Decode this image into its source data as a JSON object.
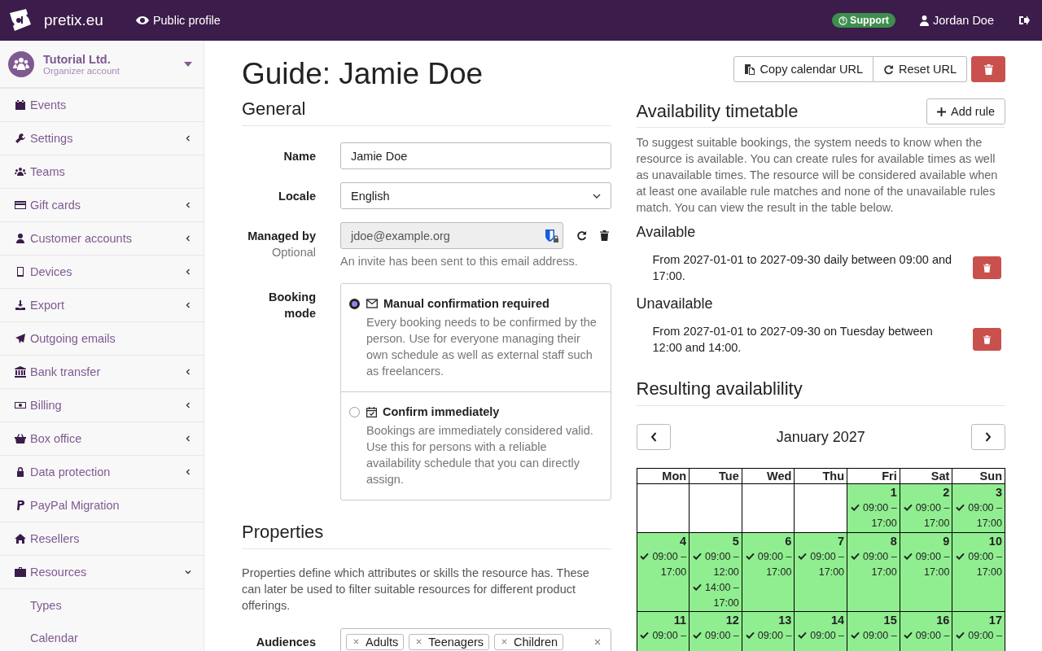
{
  "topbar": {
    "brand": "pretix.eu",
    "public_profile": "Public profile",
    "support": "Support",
    "user": "Jordan Doe"
  },
  "organizer": {
    "name": "Tutorial Ltd.",
    "subtitle": "Organizer account"
  },
  "sidebar": {
    "items": [
      {
        "label": "Events",
        "kind": "link",
        "expanded": false
      },
      {
        "label": "Settings",
        "kind": "menu",
        "expanded": false
      },
      {
        "label": "Teams",
        "kind": "link",
        "expanded": false
      },
      {
        "label": "Gift cards",
        "kind": "menu",
        "expanded": false
      },
      {
        "label": "Customer accounts",
        "kind": "menu",
        "expanded": false
      },
      {
        "label": "Devices",
        "kind": "menu",
        "expanded": false
      },
      {
        "label": "Export",
        "kind": "menu",
        "expanded": false
      },
      {
        "label": "Outgoing emails",
        "kind": "link",
        "expanded": false
      },
      {
        "label": "Bank transfer",
        "kind": "menu",
        "expanded": false
      },
      {
        "label": "Billing",
        "kind": "menu",
        "expanded": false
      },
      {
        "label": "Box office",
        "kind": "menu",
        "expanded": false
      },
      {
        "label": "Data protection",
        "kind": "menu",
        "expanded": false
      },
      {
        "label": "PayPal Migration",
        "kind": "link",
        "expanded": false
      },
      {
        "label": "Resellers",
        "kind": "link",
        "expanded": false
      },
      {
        "label": "Resources",
        "kind": "menu",
        "expanded": true,
        "children": [
          {
            "label": "Types"
          },
          {
            "label": "Calendar"
          }
        ]
      }
    ]
  },
  "page": {
    "title": "Guide: Jamie Doe",
    "actions": [
      "Copy calendar URL",
      "Reset URL"
    ]
  },
  "general": {
    "heading": "General",
    "fields": [
      {
        "kind": "text",
        "label": "Name",
        "value": "Jamie Doe",
        "disabled": false
      },
      {
        "kind": "select",
        "label": "Locale",
        "value": "English",
        "disabled": false
      },
      {
        "kind": "email",
        "label": "Managed by",
        "hint": "Optional",
        "value": "jdoe@example.org",
        "help": "An invite has been sent to this email address.",
        "disabled": true
      }
    ],
    "booking_mode": {
      "label": "Booking mode",
      "options": [
        {
          "title": "Manual confirmation required",
          "description": "Every booking needs to be confirmed by the person. Use for everyone managing their own schedule as well as external staff such as freelancers.",
          "selected": true
        },
        {
          "title": "Confirm immediately",
          "description": "Bookings are immediately considered valid. Use this for persons with a reliable availability schedule that you can directly assign.",
          "selected": false
        }
      ]
    }
  },
  "properties": {
    "heading": "Properties",
    "description": "Properties define which attributes or skills the resource has. These can later be used to filter suitable resources for different product offerings.",
    "audiences": {
      "label": "Audiences",
      "tags": [
        "Adults",
        "Teenagers",
        "Children"
      ]
    }
  },
  "availability": {
    "heading": "Availability timetable",
    "add_button": "Add rule",
    "description": "To suggest suitable bookings, the system needs to know when the resource is available. You can create rules for available times as well as unavailable times. The resource will be considered available when at least one available rule matches and none of the unavailable rules match. You can view the result in the table below.",
    "groups": [
      {
        "title": "Available",
        "rules": [
          "From 2027-01-01 to 2027-09-30 daily between 09:00 and 17:00."
        ]
      },
      {
        "title": "Unavailable",
        "rules": [
          "From 2027-01-01 to 2027-09-30 on Tuesday between 12:00 and 14:00."
        ]
      }
    ]
  },
  "result": {
    "heading": "Resulting availablility",
    "month": "January 2027",
    "weekdays": [
      "Mon",
      "Tue",
      "Wed",
      "Thu",
      "Fri",
      "Sat",
      "Sun"
    ],
    "weeks": [
      [
        {
          "available": false
        },
        {
          "available": false
        },
        {
          "available": false
        },
        {
          "available": false
        },
        {
          "day": "1",
          "available": true,
          "slots": [
            "09:00 – 17:00"
          ]
        },
        {
          "day": "2",
          "available": true,
          "slots": [
            "09:00 – 17:00"
          ]
        },
        {
          "day": "3",
          "available": true,
          "slots": [
            "09:00 – 17:00"
          ]
        }
      ],
      [
        {
          "day": "4",
          "available": true,
          "slots": [
            "09:00 – 17:00"
          ]
        },
        {
          "day": "5",
          "available": true,
          "slots": [
            "09:00 – 12:00",
            "14:00 – 17:00"
          ]
        },
        {
          "day": "6",
          "available": true,
          "slots": [
            "09:00 – 17:00"
          ]
        },
        {
          "day": "7",
          "available": true,
          "slots": [
            "09:00 – 17:00"
          ]
        },
        {
          "day": "8",
          "available": true,
          "slots": [
            "09:00 – 17:00"
          ]
        },
        {
          "day": "9",
          "available": true,
          "slots": [
            "09:00 – 17:00"
          ]
        },
        {
          "day": "10",
          "available": true,
          "slots": [
            "09:00 – 17:00"
          ]
        }
      ],
      [
        {
          "day": "11",
          "available": true,
          "slots": [
            "09:00 –"
          ]
        },
        {
          "day": "12",
          "available": true,
          "slots": [
            "09:00 –"
          ]
        },
        {
          "day": "13",
          "available": true,
          "slots": [
            "09:00 –"
          ]
        },
        {
          "day": "14",
          "available": true,
          "slots": [
            "09:00 –"
          ]
        },
        {
          "day": "15",
          "available": true,
          "slots": [
            "09:00 –"
          ]
        },
        {
          "day": "16",
          "available": true,
          "slots": [
            "09:00 –"
          ]
        },
        {
          "day": "17",
          "available": true,
          "slots": [
            "09:00 –"
          ]
        }
      ]
    ]
  }
}
